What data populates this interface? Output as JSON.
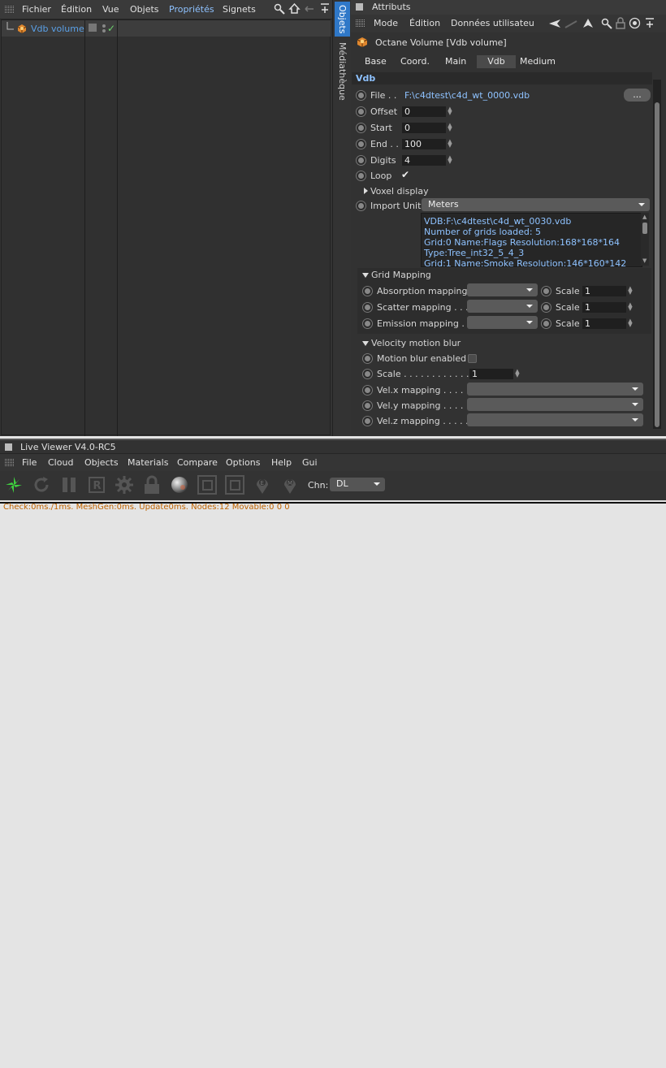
{
  "object_manager": {
    "menu": [
      "Fichier",
      "Édition",
      "Vue",
      "Objets",
      "Propriétés",
      "Signets"
    ],
    "object_name": "Vdb volume"
  },
  "side_tabs": [
    "Objets",
    "Médiathèque"
  ],
  "attributes": {
    "title": "Attributs",
    "menu": [
      "Mode",
      "Édition",
      "Données utilisateu"
    ],
    "object_label": "Octane Volume [Vdb volume]",
    "tabs": [
      "Base",
      "Coord.",
      "Main",
      "Vdb",
      "Medium"
    ],
    "active_tab": "Vdb",
    "section": "Vdb",
    "file_label": "File . .",
    "file_value": "F:\\c4dtest\\c4d_wt_0000.vdb",
    "browse_label": "...",
    "offset_label": "Offset",
    "offset_value": "0",
    "start_label": "Start",
    "start_value": "0",
    "end_label": "End . .",
    "end_value": "100",
    "digits_label": "Digits",
    "digits_value": "4",
    "loop_label": "Loop",
    "loop_check": "✔",
    "voxel_label": "Voxel display",
    "import_unit_label": "Import Unit",
    "import_unit_value": "Meters",
    "info_lines": [
      "VDB:F:\\c4dtest\\c4d_wt_0030.vdb",
      "Number of grids loaded: 5",
      "Grid:0  Name:Flags  Resolution:168*168*164",
      "Type:Tree_int32_5_4_3",
      "Grid:1  Name:Smoke  Resolution:146*160*142"
    ],
    "grid_mapping": {
      "title": "Grid Mapping",
      "rows": [
        {
          "label": "Absorption mapping",
          "scale_label": "Scale",
          "scale": "1"
        },
        {
          "label": "Scatter mapping . . . .",
          "scale_label": "Scale",
          "scale": "1"
        },
        {
          "label": "Emission mapping  . .",
          "scale_label": "Scale",
          "scale": "1"
        }
      ]
    },
    "velocity": {
      "title": "Velocity motion blur",
      "motion_label": "Motion blur enabled",
      "scale_label": "Scale . . . . . . . . . . . . . .",
      "scale_value": "1",
      "vel_rows": [
        "Vel.x mapping . . . . . .",
        "Vel.y mapping . . . . . .",
        "Vel.z mapping . . . . . ."
      ]
    }
  },
  "live_viewer": {
    "title": "Live Viewer V4.0-RC5",
    "menu": [
      "File",
      "Cloud",
      "Objects",
      "Materials",
      "Compare",
      "Options",
      "Help",
      "Gui"
    ],
    "chn_label": "Chn:",
    "chn_value": "DL",
    "status": "Check:0ms./1ms. MeshGen:0ms. Update0ms. Nodes:12 Movable:0  0 0"
  },
  "colors": {
    "accent_blue": "#5aa0e6",
    "status_orange": "#c06400",
    "active_menu": "#6fb0ff"
  }
}
